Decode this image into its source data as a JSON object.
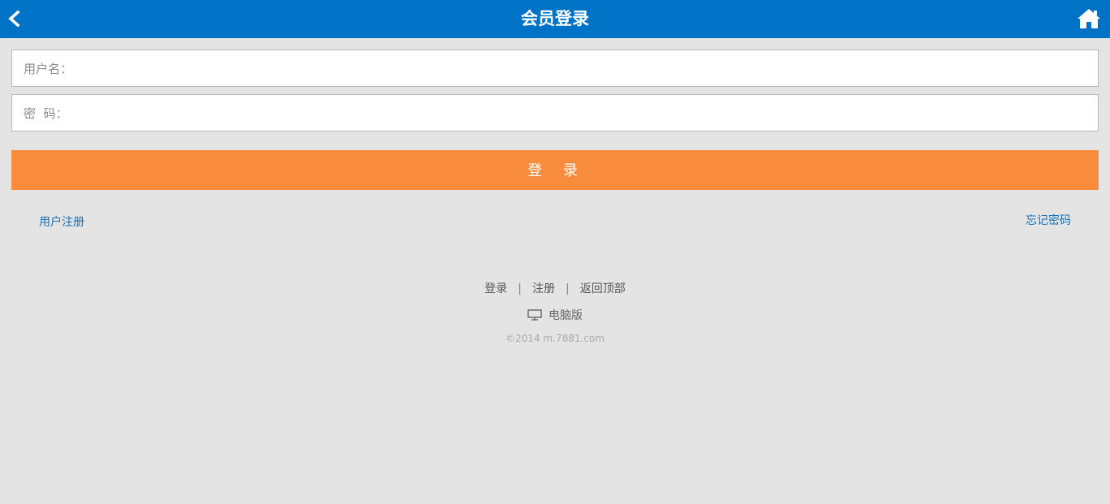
{
  "header": {
    "title": "会员登录",
    "back_icon": "chevron-left-icon",
    "home_icon": "home-icon",
    "bg_color": "#0073c6"
  },
  "form": {
    "username_label": "用户名：",
    "username_value": "",
    "password_label": "密  码：",
    "password_value": "",
    "login_label": "登 录",
    "login_color": "#f98b3c"
  },
  "links": {
    "register": "用户注册",
    "forgot": "忘记密码"
  },
  "footer": {
    "login": "登录",
    "separator": "|",
    "register": "注册",
    "back_to_top": "返回顶部",
    "pc_version": "电脑版",
    "pc_icon": "monitor-icon",
    "copyright": "©2014 m.7881.com"
  }
}
